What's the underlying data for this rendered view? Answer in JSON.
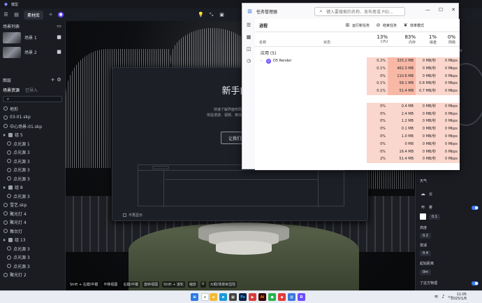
{
  "app": {
    "title": "模型",
    "tab_material": "素材库"
  },
  "left_panel": {
    "scene_list_title": "场景列表",
    "scenes": [
      "场景 1",
      "场景 2"
    ],
    "layers_title": "图层",
    "tabs": [
      "场景资源",
      "已导入"
    ],
    "tree": [
      {
        "label": "地形",
        "type": "item",
        "level": 0
      },
      {
        "label": "03-01.skp",
        "type": "item",
        "level": 0
      },
      {
        "label": "中心场景-01.skp",
        "type": "item",
        "level": 0
      },
      {
        "label": "组 5",
        "type": "group",
        "level": 0
      },
      {
        "label": "点光源 1",
        "type": "item",
        "level": 1
      },
      {
        "label": "点光源 3",
        "type": "item",
        "level": 1
      },
      {
        "label": "点光源 3",
        "type": "item",
        "level": 1
      },
      {
        "label": "点光源 3",
        "type": "item",
        "level": 1
      },
      {
        "label": "点光源 3",
        "type": "item",
        "level": 1
      },
      {
        "label": "组 8",
        "type": "group",
        "level": 0
      },
      {
        "label": "点光源 3",
        "type": "item",
        "level": 1
      },
      {
        "label": "雪艺.skp",
        "type": "item",
        "level": 0
      },
      {
        "label": "聚光灯 4",
        "type": "item",
        "level": 0
      },
      {
        "label": "聚光灯 4",
        "type": "item",
        "level": 0
      },
      {
        "label": "舞台灯",
        "type": "item",
        "level": 0
      },
      {
        "label": "组 13",
        "type": "group",
        "level": 0
      },
      {
        "label": "点光源 3",
        "type": "item",
        "level": 1
      },
      {
        "label": "点光源 3",
        "type": "item",
        "level": 1
      },
      {
        "label": "点光源 3",
        "type": "item",
        "level": 1
      },
      {
        "label": "聚光灯 2",
        "type": "item",
        "level": 0
      }
    ]
  },
  "viewport": {
    "hints": [
      "Shift + 右键/中键",
      "平移视图",
      "右键/中键",
      "旋转视图",
      "Shift + 滚轮",
      "缩放",
      "U",
      "大纲/场景树显隐"
    ]
  },
  "dialog": {
    "title": "新手向导",
    "text_line1": "快速了解界面布局和功能分布区。",
    "text_line2": "体验漫游、视频、离线的沉浸式创作过程。",
    "button": "让我们开始吧",
    "no_show": "不再显示"
  },
  "right_panel": {
    "hdri_label": "HDRI",
    "weather_title": "天气",
    "cloud_label": "云",
    "fog_label": "雾",
    "fog_value": "0.1",
    "height_label": "高度",
    "height_value": "0.2",
    "density_label": "衰减",
    "density_value": "0.4",
    "start_label": "起始距离",
    "start_value": "0m",
    "volumetric_label": "了这方物理"
  },
  "task_manager": {
    "title": "任务管理器",
    "search_placeholder": "键入要搜索的名称、发布者或 PID...",
    "section": "进程",
    "actions": [
      "运行新任务",
      "结束任务",
      "效率模式"
    ],
    "columns": {
      "name": "名称",
      "status": "状态",
      "cpu_pct": "13%",
      "cpu": "CPU",
      "mem_pct": "83%",
      "mem": "内存",
      "disk_pct": "1%",
      "disk": "磁盘",
      "net_pct": "0%",
      "net": "网络"
    },
    "group_label": "应用 (5)",
    "rows": [
      {
        "name": "D5 Render",
        "cpu": "0.2%",
        "mem": "325.2 MB",
        "disk": "0 MB/秒",
        "net": "0 Mbps"
      },
      {
        "name": "",
        "cpu": "0.1%",
        "mem": "462.3 MB",
        "disk": "0 MB/秒",
        "net": "0 Mbps"
      },
      {
        "name": "",
        "cpu": "0%",
        "mem": "110.6 MB",
        "disk": "0 MB/秒",
        "net": "0 Mbps"
      },
      {
        "name": "",
        "cpu": "0.1%",
        "mem": "58.1 MB",
        "disk": "0.8 MB/秒",
        "net": "0 Mbps"
      },
      {
        "name": "",
        "cpu": "0.1%",
        "mem": "51.4 MB",
        "disk": "0.7 MB/秒",
        "net": "0 Mbps"
      },
      {
        "name": "",
        "cpu": "",
        "mem": "",
        "disk": "",
        "net": ""
      },
      {
        "name": "",
        "cpu": "0%",
        "mem": "0.4 MB",
        "disk": "0 MB/秒",
        "net": "0 Mbps"
      },
      {
        "name": "",
        "cpu": "0%",
        "mem": "2.4 MB",
        "disk": "0 MB/秒",
        "net": "0 Mbps"
      },
      {
        "name": "",
        "cpu": "0%",
        "mem": "1.2 MB",
        "disk": "0 MB/秒",
        "net": "0 Mbps"
      },
      {
        "name": "",
        "cpu": "0%",
        "mem": "0.1 MB",
        "disk": "0 MB/秒",
        "net": "0 Mbps"
      },
      {
        "name": "",
        "cpu": "0%",
        "mem": "1.0 MB",
        "disk": "0 MB/秒",
        "net": "0 Mbps"
      },
      {
        "name": "",
        "cpu": "0%",
        "mem": "0 MB",
        "disk": "0 MB/秒",
        "net": "0 Mbps"
      },
      {
        "name": "",
        "cpu": "0%",
        "mem": "16.4 MB",
        "disk": "0 MB/秒",
        "net": "0 Mbps"
      },
      {
        "name": "",
        "cpu": "2%",
        "mem": "51.4 MB",
        "disk": "0 MB/秒",
        "net": "0 Mbps"
      }
    ]
  },
  "taskbar": {
    "time": "11:05",
    "date": "2025/1/8"
  },
  "colors": {
    "accent": "#3d7cf5",
    "panel": "#1a1c22",
    "tm_highlight": "#fbd6cc",
    "tm_highlight_strong": "#f7b8a6"
  }
}
